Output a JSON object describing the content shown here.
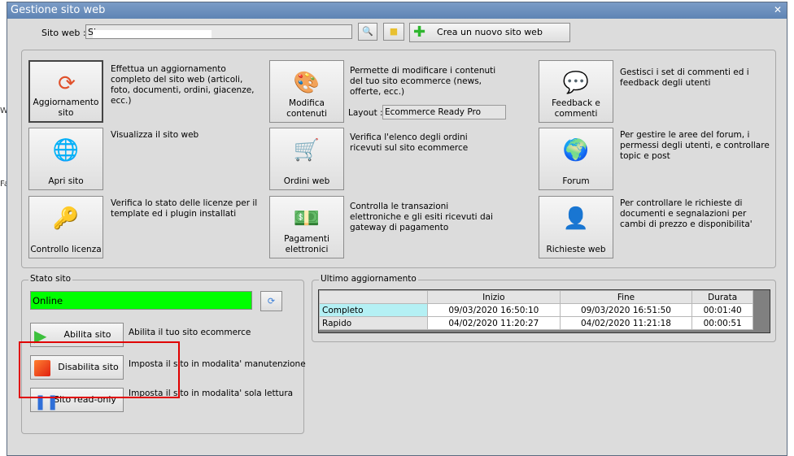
{
  "window": {
    "title": "Gestione sito web"
  },
  "background": {
    "t1": "We",
    "t2": "Fa"
  },
  "top": {
    "site_label": "Sito web :",
    "site_value": "Si",
    "new_site": "Crea un nuovo sito web"
  },
  "actions": [
    {
      "label": "Aggiornamento sito",
      "desc": "Effettua un aggiornamento completo del sito web (articoli, foto, documenti, ordini, giacenze, ecc.)"
    },
    {
      "label": "Modifica contenuti",
      "desc": "Permette di modificare i contenuti del tuo sito ecommerce (news, offerte, ecc.)"
    },
    {
      "label": "Feedback e commenti",
      "desc": "Gestisci i set di commenti ed i feedback degli utenti"
    },
    {
      "label": "Apri sito",
      "desc": "Visualizza il sito web"
    },
    {
      "label": "Ordini web",
      "desc": "Verifica l'elenco degli ordini ricevuti sul sito ecommerce"
    },
    {
      "label": "Forum",
      "desc": "Per gestire le aree del forum, i permessi degli utenti, e controllare topic e post"
    },
    {
      "label": "Controllo licenza",
      "desc": "Verifica lo stato delle licenze per il template ed i plugin installati"
    },
    {
      "label": "Pagamenti elettronici",
      "desc": "Controlla le transazioni elettroniche e gli esiti ricevuti dai gateway di pagamento"
    },
    {
      "label": "Richieste web",
      "desc": "Per controllare le richieste di documenti e segnalazioni per cambi di prezzo e disponibilita'"
    }
  ],
  "layout": {
    "label": "Layout :",
    "value": "Ecommerce Ready Pro"
  },
  "stato": {
    "title": "Stato sito",
    "status": "Online",
    "status_color": "#00ff00",
    "abilita": "Abilita sito",
    "abilita_desc": "Abilita il tuo sito ecommerce",
    "disabilita": "Disabilita sito",
    "disabilita_desc": "Imposta il sito in modalita' manutenzione",
    "readonly": "Sito read-only",
    "readonly_desc": "Imposta il sito in modalita' sola lettura"
  },
  "ultimo": {
    "title": "Ultimo aggiornamento",
    "headers": [
      "",
      "Inizio",
      "Fine",
      "Durata"
    ],
    "rows": [
      [
        "Completo",
        "09/03/2020 16:50:10",
        "09/03/2020 16:51:50",
        "00:01:40"
      ],
      [
        "Rapido",
        "04/02/2020 11:20:27",
        "04/02/2020 11:21:18",
        "00:00:51"
      ]
    ]
  }
}
